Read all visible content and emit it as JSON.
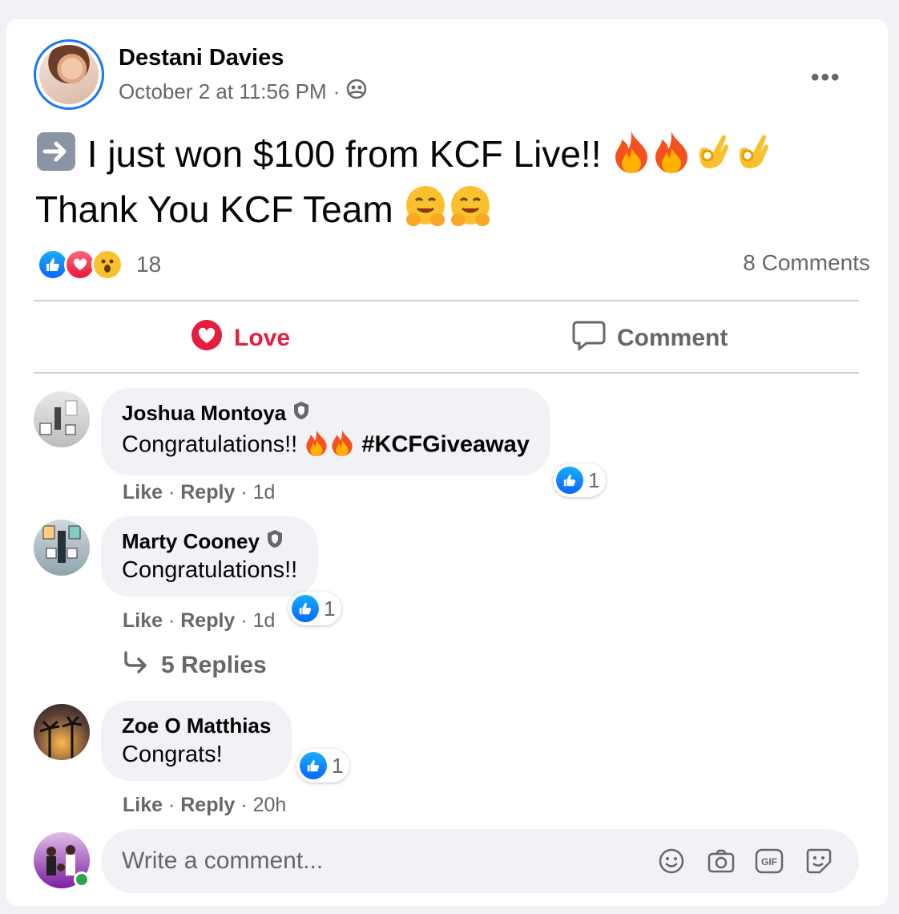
{
  "post": {
    "author": "Destani Davies",
    "timestamp": "October 2 at 11:56 PM",
    "separator": "·",
    "audience_icon": "friends-icon",
    "more_label": "•••",
    "line1_text": " I just won $100 from KCF Live!! ",
    "line2_text": "Thank You KCF Team ",
    "reaction_count": "18",
    "comments_label": "8 Comments"
  },
  "actions": {
    "love_label": "Love",
    "comment_label": "Comment"
  },
  "comments": [
    {
      "name": "Joshua Montoya",
      "text": "Congratulations!! ",
      "hashtag": "#KCFGiveaway",
      "like": "Like",
      "reply": "Reply",
      "time": "1d",
      "reactions": "1"
    },
    {
      "name": "Marty Cooney",
      "text": "Congratulations!!",
      "like": "Like",
      "reply": "Reply",
      "time": "1d",
      "reactions": "1"
    },
    {
      "name": "Zoe O Matthias",
      "text": "Congrats!",
      "like": "Like",
      "reply": "Reply",
      "time": "20h",
      "reactions": "1"
    }
  ],
  "replies_label": "5 Replies",
  "composer": {
    "placeholder": "Write a comment...",
    "gif_label": "GIF"
  },
  "colors": {
    "accent": "#1877f2",
    "love": "#e41e3f",
    "secondary_text": "#65676b"
  }
}
